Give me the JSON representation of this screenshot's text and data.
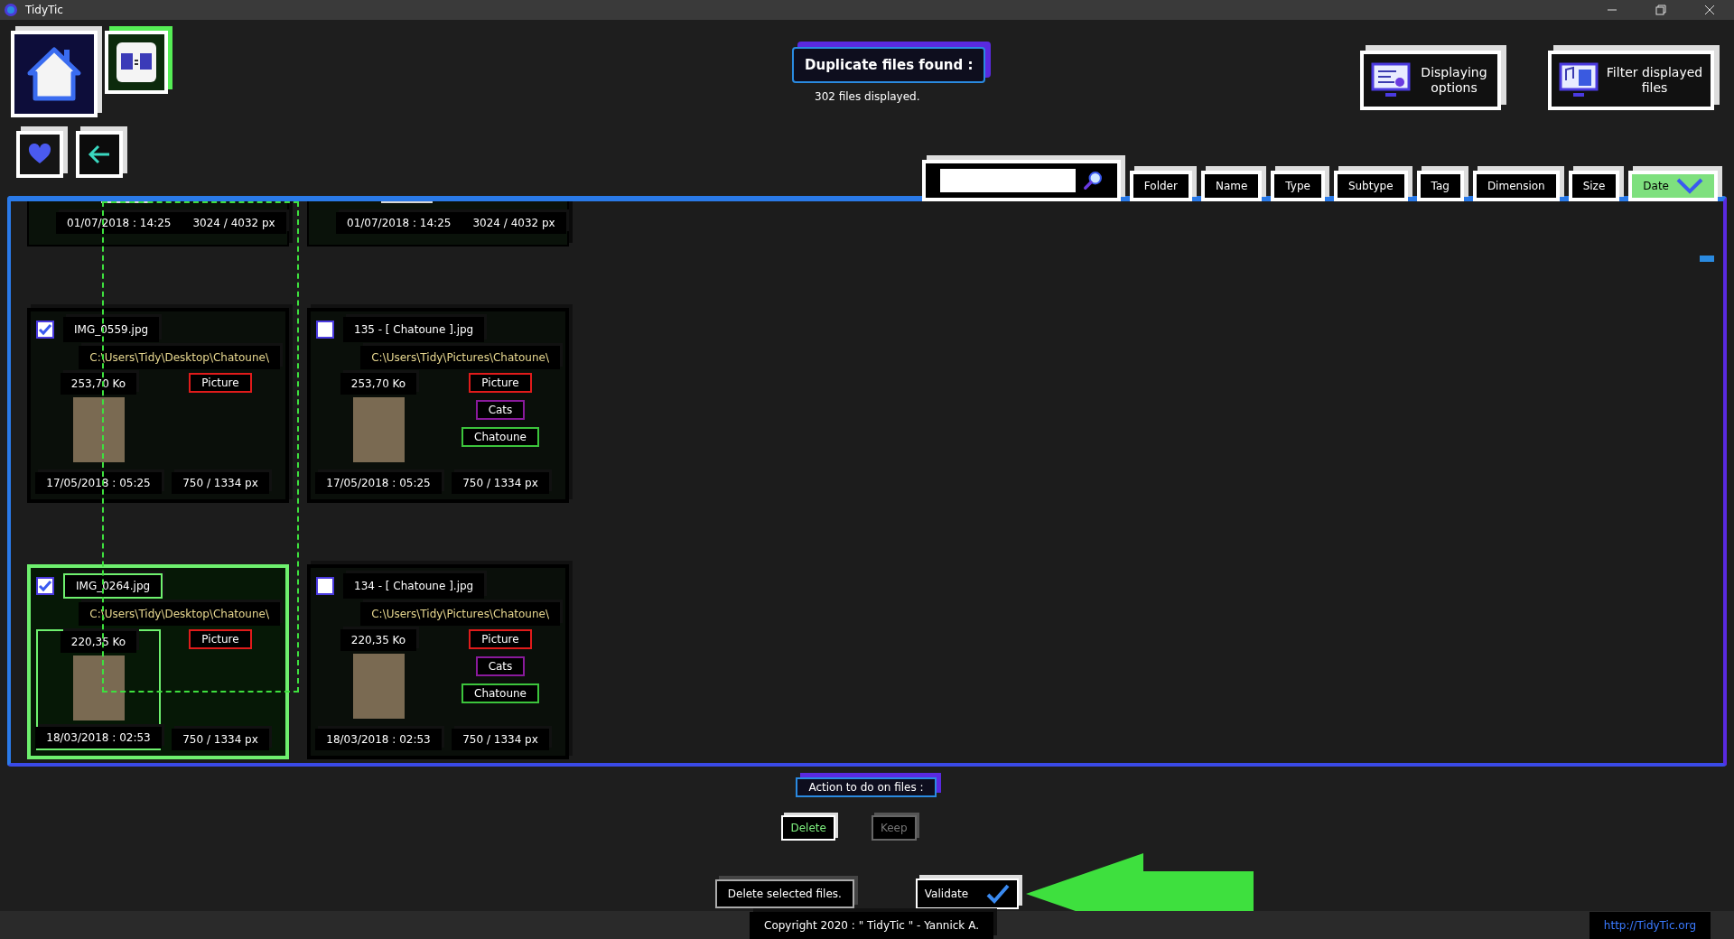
{
  "window": {
    "title": "TidyTic"
  },
  "header": {
    "title": "Duplicate files found :",
    "subtitle": "302 files displayed.",
    "buttons": [
      {
        "label": "Displaying options",
        "kind": "display"
      },
      {
        "label": "Filter displayed files",
        "kind": "filter"
      }
    ]
  },
  "sort_buttons": [
    {
      "label": "Folder",
      "selected": false
    },
    {
      "label": "Name",
      "selected": false
    },
    {
      "label": "Type",
      "selected": false
    },
    {
      "label": "Subtype",
      "selected": false
    },
    {
      "label": "Tag",
      "selected": false
    },
    {
      "label": "Dimension",
      "selected": false
    },
    {
      "label": "Size",
      "selected": false
    },
    {
      "label": "Date",
      "selected": true
    }
  ],
  "card_rows": [
    [
      {
        "kind": "partial",
        "date": "01/07/2018 : 14:25",
        "dimension": "3024 / 4032 px"
      },
      {
        "kind": "partial",
        "date": "01/07/2018 : 14:25",
        "dimension": "3024 / 4032 px"
      }
    ],
    [
      {
        "kind": "full",
        "checked": true,
        "selected": false,
        "name": "IMG_0559.jpg",
        "path": "C:\\Users\\Tidy\\Desktop\\Chatoune\\",
        "size": "253,70 Ko",
        "tags": [
          {
            "label": "Picture",
            "color": "#e01b1b"
          }
        ],
        "date": "17/05/2018 : 05:25",
        "dimension": "750 / 1334 px"
      },
      {
        "kind": "full",
        "checked": false,
        "selected": false,
        "name": "135 - [ Chatoune ].jpg",
        "path": "C:\\Users\\Tidy\\Pictures\\Chatoune\\",
        "size": "253,70 Ko",
        "tags": [
          {
            "label": "Picture",
            "color": "#e01b1b"
          },
          {
            "label": "Cats",
            "color": "#8a1a9c"
          },
          {
            "label": "Chatoune",
            "color": "#3cc43c"
          }
        ],
        "date": "17/05/2018 : 05:25",
        "dimension": "750 / 1334 px"
      }
    ],
    [
      {
        "kind": "full",
        "checked": true,
        "selected": true,
        "name": "IMG_0264.jpg",
        "path": "C:\\Users\\Tidy\\Desktop\\Chatoune\\",
        "size": "220,35 Ko",
        "tags": [
          {
            "label": "Picture",
            "color": "#e01b1b"
          }
        ],
        "date": "18/03/2018 : 02:53",
        "dimension": "750 / 1334 px"
      },
      {
        "kind": "full",
        "checked": false,
        "selected": false,
        "name": "134 - [ Chatoune ].jpg",
        "path": "C:\\Users\\Tidy\\Pictures\\Chatoune\\",
        "size": "220,35 Ko",
        "tags": [
          {
            "label": "Picture",
            "color": "#e01b1b"
          },
          {
            "label": "Cats",
            "color": "#8a1a9c"
          },
          {
            "label": "Chatoune",
            "color": "#3cc43c"
          }
        ],
        "date": "18/03/2018 : 02:53",
        "dimension": "750 / 1334 px"
      }
    ]
  ],
  "actions": {
    "label": "Action to do on files :",
    "options": [
      {
        "label": "Delete",
        "selected": true
      },
      {
        "label": "Keep",
        "selected": false
      }
    ],
    "summary": "Delete selected files.",
    "validate": "Validate"
  },
  "footer": {
    "copyright": "Copyright 2020 : \" TidyTic \" - Yannick A.",
    "link": "http://TidyTic.org"
  }
}
